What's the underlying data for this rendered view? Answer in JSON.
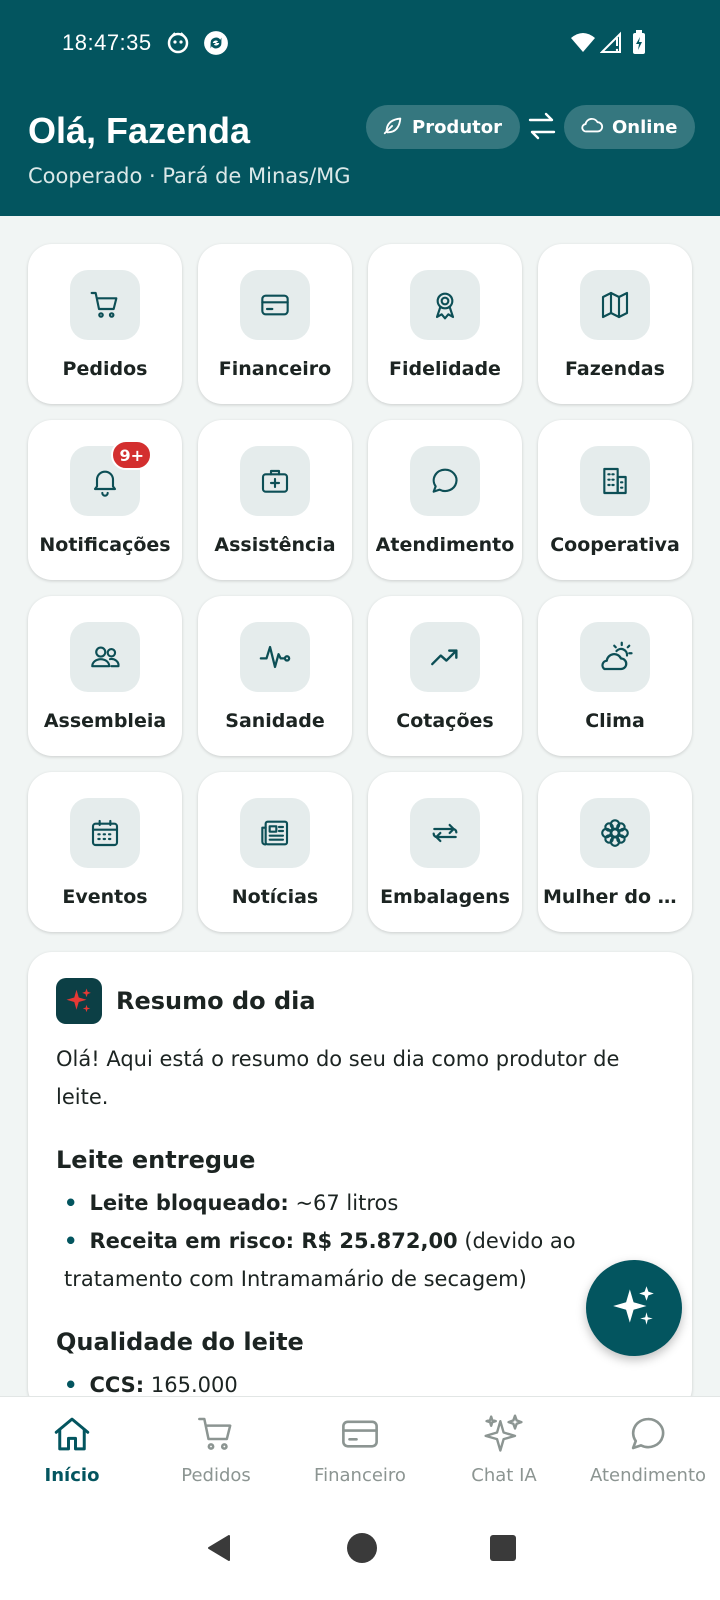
{
  "status": {
    "time": "18:47:35"
  },
  "header": {
    "title": "Olá, Fazenda",
    "subtitle": "Cooperado · Pará de Minas/MG",
    "role_pill": "Produtor",
    "online_pill": "Online"
  },
  "grid": [
    {
      "label": "Pedidos",
      "icon": "cart-icon"
    },
    {
      "label": "Financeiro",
      "icon": "credit-card-icon"
    },
    {
      "label": "Fidelidade",
      "icon": "award-icon"
    },
    {
      "label": "Fazendas",
      "icon": "map-icon"
    },
    {
      "label": "Notificações",
      "icon": "bell-icon",
      "badge": "9+"
    },
    {
      "label": "Assistência",
      "icon": "medkit-icon"
    },
    {
      "label": "Atendimento",
      "icon": "chat-bubble-icon"
    },
    {
      "label": "Cooperativa",
      "icon": "building-icon"
    },
    {
      "label": "Assembleia",
      "icon": "people-icon"
    },
    {
      "label": "Sanidade",
      "icon": "pulse-icon"
    },
    {
      "label": "Cotações",
      "icon": "trending-up-icon"
    },
    {
      "label": "Clima",
      "icon": "sun-cloud-icon"
    },
    {
      "label": "Eventos",
      "icon": "calendar-icon"
    },
    {
      "label": "Notícias",
      "icon": "newspaper-icon"
    },
    {
      "label": "Embalagens",
      "icon": "swap-icon"
    },
    {
      "label": "Mulher do C...",
      "icon": "flower-icon"
    }
  ],
  "summary": {
    "title": "Resumo do dia",
    "intro": "Olá! Aqui está o resumo do seu dia como produtor de leite.",
    "section1_title": "Leite entregue",
    "item1_label": "Leite bloqueado:",
    "item1_value": " ~67 litros",
    "item2_label": "Receita em risco: R$ 25.872,00",
    "item2_value": " (devido ao tratamento com Intramamário de secagem)",
    "section2_title": "Qualidade do leite",
    "item3_label": "CCS:",
    "item3_value": " 165.000"
  },
  "bottom_nav": [
    {
      "label": "Início",
      "icon": "home-icon",
      "active": true
    },
    {
      "label": "Pedidos",
      "icon": "cart-icon"
    },
    {
      "label": "Financeiro",
      "icon": "credit-card-icon"
    },
    {
      "label": "Chat IA",
      "icon": "sparkles-icon"
    },
    {
      "label": "Atendimento",
      "icon": "chat-bubble-icon"
    }
  ],
  "colors": {
    "primary": "#03555f",
    "badge": "#d32f2f",
    "tile_icon_bg": "#e5ecec"
  }
}
